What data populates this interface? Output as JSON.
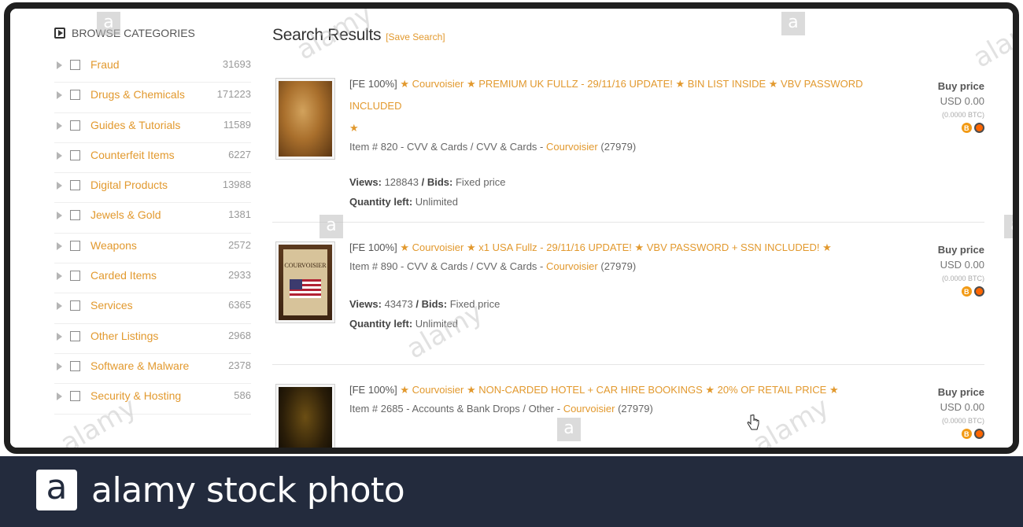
{
  "sidebar": {
    "heading": "BROWSE CATEGORIES",
    "categories": [
      {
        "label": "Fraud",
        "count": "31693"
      },
      {
        "label": "Drugs & Chemicals",
        "count": "171223"
      },
      {
        "label": "Guides & Tutorials",
        "count": "11589"
      },
      {
        "label": "Counterfeit Items",
        "count": "6227"
      },
      {
        "label": "Digital Products",
        "count": "13988"
      },
      {
        "label": "Jewels & Gold",
        "count": "1381"
      },
      {
        "label": "Weapons",
        "count": "2572"
      },
      {
        "label": "Carded Items",
        "count": "2933"
      },
      {
        "label": "Services",
        "count": "6365"
      },
      {
        "label": "Other Listings",
        "count": "2968"
      },
      {
        "label": "Software & Malware",
        "count": "2378"
      },
      {
        "label": "Security & Hosting",
        "count": "586"
      }
    ]
  },
  "results": {
    "title": "Search Results",
    "save_link": "[Save Search]",
    "items": [
      {
        "fe": "[FE 100%]",
        "seller": "Courvoisier",
        "title": "PREMIUM UK FULLZ - 29/11/16 UPDATE! ★ BIN LIST INSIDE ★ VBV PASSWORD INCLUDED",
        "item_prefix": "Item # 820 - CVV & Cards / CVV & Cards - ",
        "seller_ref": "Courvoisier",
        "seller_score": "(27979)",
        "views_label": "Views:",
        "views": "128843",
        "bids_label": "/ Bids:",
        "bids": "Fixed price",
        "qty_label": "Quantity left:",
        "qty": "Unlimited",
        "buy_label": "Buy price",
        "usd": "USD 0.00",
        "btc": "(0.0000 BTC)"
      },
      {
        "fe": "[FE 100%]",
        "seller": "Courvoisier",
        "title": "x1 USA Fullz - 29/11/16 UPDATE! ★ VBV PASSWORD + SSN INCLUDED!",
        "item_prefix": "Item # 890 - CVV & Cards / CVV & Cards - ",
        "seller_ref": "Courvoisier",
        "seller_score": "(27979)",
        "views_label": "Views:",
        "views": "43473",
        "bids_label": "/ Bids:",
        "bids": "Fixed price",
        "qty_label": "Quantity left:",
        "qty": "Unlimited",
        "buy_label": "Buy price",
        "usd": "USD 0.00",
        "btc": "(0.0000 BTC)",
        "thumb_caption": "COURVOISIER"
      },
      {
        "fe": "[FE 100%]",
        "seller": "Courvoisier",
        "title": "NON-CARDED HOTEL + CAR HIRE BOOKINGS ★ 20% OF RETAIL PRICE",
        "item_prefix": "Item # 2685 - Accounts & Bank Drops / Other - ",
        "seller_ref": "Courvoisier",
        "seller_score": "(27979)",
        "buy_label": "Buy price",
        "usd": "USD 0.00",
        "btc": "(0.0000 BTC)"
      }
    ]
  },
  "watermark": {
    "brand_letter": "a",
    "brand_text": "alamy stock photo",
    "tile_text": "alamy"
  },
  "colors": {
    "accent": "#e2992e",
    "footer_bg": "#232b3d",
    "bezel": "#1f1f1f"
  }
}
